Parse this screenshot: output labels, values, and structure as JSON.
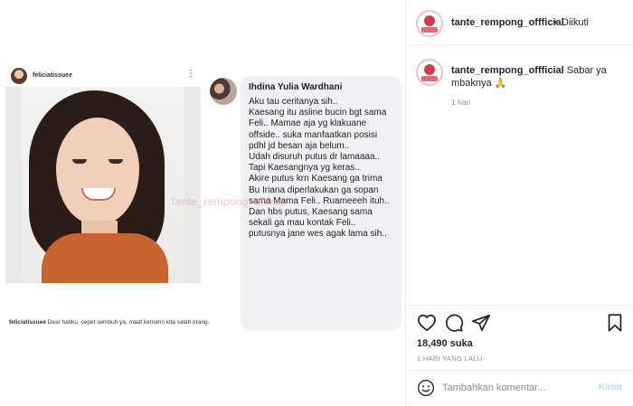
{
  "post_image": {
    "mini_post": {
      "username": "feliciatissuee",
      "more_glyph": "⋮",
      "caption_user": "feliciatissuee",
      "caption_text": " Dear hatiku, cepet sembuh ya, maaf kemarin kita salah orang."
    },
    "comment": {
      "author": "Ihdina Yulia Wardhani",
      "text": "Aku tau ceritanya sih..\nKaesang itu asline bucin bgt sama Feli.. Mamae aja yg klakuane offside.. suka manfaatkan posisi pdhl jd besan aja belum..\nUdah disuruh putus dr lamaaaa.. Tapi Kaesangnya yg keras..\nAkire putus krn Kaesang ga trima Bu Iriana diperlakukan ga sopan sama Mama Feli.. Ruameeeh ituh..\nDan hbs putus, Kaesang sama sekali ga mau kontak Feli.. putusnya jane wes agak lama sih.."
    },
    "watermark": "tante_rempong_official"
  },
  "panel": {
    "header": {
      "username": "tante_rempong_offficial",
      "separator": "•",
      "follow_status": "Diikuti"
    },
    "caption": {
      "username": "tante_rempong_offficial",
      "text": "Sabar ya mbaknya 🙏",
      "time": "1 hari"
    },
    "likes": "18,490 suka",
    "post_date": "1 HARI YANG LALU",
    "comment_input": {
      "placeholder": "Tambahkan komentar...",
      "send_label": "Kirim"
    }
  },
  "icons": {
    "like": "heart-icon",
    "comment": "comment-icon",
    "share": "paper-plane-icon",
    "save": "bookmark-icon",
    "emoji": "smiley-icon"
  },
  "colors": {
    "send_disabled": "#b2dffc",
    "muted_text": "#8e8e8e",
    "border": "#efefef"
  }
}
